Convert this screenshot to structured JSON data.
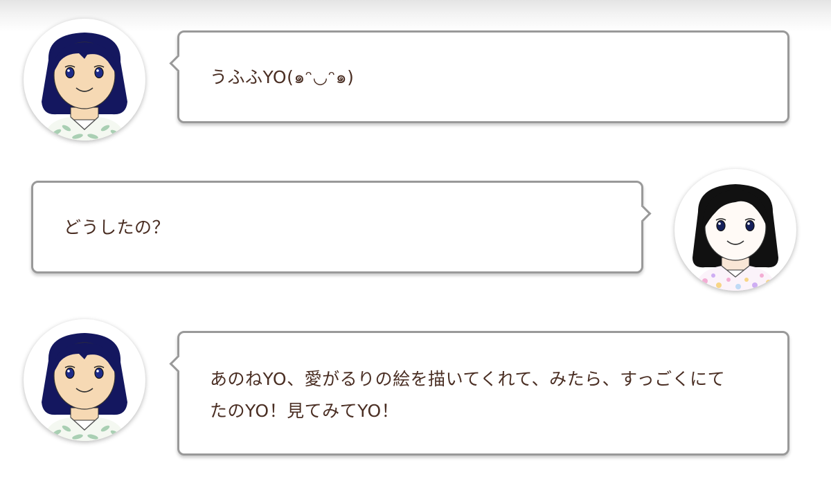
{
  "messages": [
    {
      "speaker": "blue-hair-girl",
      "side": "left",
      "lines": [
        "うふふYO(๑ᵔ◡ᵔ๑)"
      ]
    },
    {
      "speaker": "black-hair-girl",
      "side": "right",
      "lines": [
        "どうしたの？"
      ]
    },
    {
      "speaker": "blue-hair-girl",
      "side": "left",
      "lines": [
        "あのねYO、愛がるりの絵を描いてくれて、みたら、すっごくにて",
        "たのYO！見てみてYO！"
      ]
    }
  ],
  "colors": {
    "text": "#4a2e23",
    "bubble_border": "#999999",
    "blue_hair": "#14175f",
    "black_hair": "#111111",
    "skin": "#f6d9b4"
  }
}
